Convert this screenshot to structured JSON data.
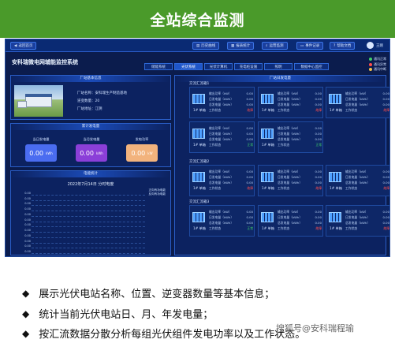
{
  "banner": {
    "title": "全站综合监测"
  },
  "topbar": {
    "back": "返回首页",
    "buttons": [
      "历史曲线",
      "报表统计",
      "运营监测",
      "事件记录",
      "帮助文档"
    ],
    "user": "王刚"
  },
  "system": {
    "title": "安科瑞微电网辅能监控系统",
    "tabs": [
      "储能系统",
      "光伏系统",
      "光伏计算机",
      "充电桩设施",
      "照明",
      "数据中心监控"
    ],
    "active_tab": 1,
    "legend": [
      {
        "label": "通讯正常",
        "color": "#3fd16a"
      },
      {
        "label": "通讯异常",
        "color": "#ff4d4d"
      },
      {
        "label": "通讯中断",
        "color": "#f0c24b"
      }
    ]
  },
  "station": {
    "panel_title": "厂站基本信息",
    "name_label": "厂站名称：安科瑞生产制造基地",
    "count_label": "逆变数量：20",
    "address_label": "厂站地址：江阴"
  },
  "generation": {
    "panel_title": "累计发电量",
    "cards": [
      {
        "label": "当日发电量",
        "value": "0.00",
        "unit": "kWh",
        "color": "#4a6cf0"
      },
      {
        "label": "当月发电量",
        "value": "0.00",
        "unit": "kWh",
        "color": "#8b3fd8"
      },
      {
        "label": "发电功率",
        "value": "0.00",
        "unit": "kW",
        "color": "#f2b37d"
      }
    ]
  },
  "power_stats": {
    "panel_title": "电能统计",
    "chart_title": "2022年7月14日 分时电度",
    "legend": [
      "正向有功电能",
      "反向有功电能"
    ],
    "yticks": [
      "0.00",
      "0.00",
      "0.00",
      "0.00",
      "0.00",
      "0.00",
      "0.00",
      "0.00",
      "0.00",
      "0.00",
      "0.00",
      "0.00"
    ]
  },
  "inverters": {
    "panel_title": "厂站日发电量",
    "groups": [
      {
        "label": "交流汇流箱1",
        "items": [
          {
            "name": "1# 单箱",
            "status": "故障",
            "ok": false
          },
          {
            "name": "1# 单箱",
            "status": "故障",
            "ok": false
          },
          {
            "name": "1# 单箱",
            "status": "故障",
            "ok": false
          },
          {
            "name": "1# 单箱",
            "status": "正常",
            "ok": true
          },
          {
            "name": "1# 单箱",
            "status": "正常",
            "ok": true
          }
        ]
      },
      {
        "label": "交流汇流箱2",
        "items": [
          {
            "name": "1# 单箱",
            "status": "故障",
            "ok": false
          },
          {
            "name": "1# 单箱",
            "status": "故障",
            "ok": false
          },
          {
            "name": "1# 单箱",
            "status": "故障",
            "ok": false
          }
        ]
      },
      {
        "label": "交流汇流箱3",
        "items": [
          {
            "name": "1# 单箱",
            "status": "正常",
            "ok": true
          },
          {
            "name": "1# 单箱",
            "status": "故障",
            "ok": false
          },
          {
            "name": "1# 单箱",
            "status": "故障",
            "ok": false
          }
        ]
      }
    ],
    "fields": [
      "输出功率（kW）",
      "日发电量（kWh）",
      "总发电量（kWh）",
      "工作状态"
    ],
    "value": "0.00"
  },
  "bullets": [
    "展示光伏电站名称、位置、逆变器数量等基本信息；",
    "统计当前光伏电站日、月、年发电量；",
    "按汇流数据分散分析每组光伏组件发电功率以及工作状态。"
  ],
  "watermark": "搜狐号@安科瑞程瑜"
}
